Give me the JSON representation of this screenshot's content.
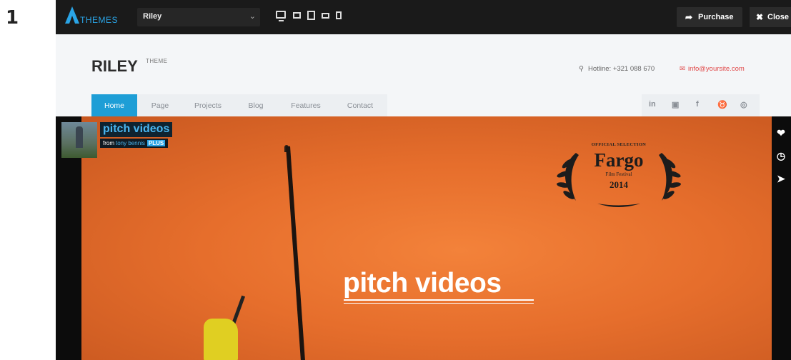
{
  "step_number": "1",
  "topbar": {
    "logo_text": "THEMES",
    "theme_select_value": "Riley",
    "purchase_label": "Purchase",
    "close_label": "Close",
    "icons": [
      "desktop-icon",
      "laptop-icon",
      "tablet-icon",
      "tablet-landscape-icon",
      "phone-icon"
    ]
  },
  "site": {
    "brand": "RILEY",
    "brand_sup": "THEME",
    "hotline": "Hotline: +321 088 670",
    "email": "info@yoursite.com",
    "nav": [
      {
        "label": "Home",
        "active": true
      },
      {
        "label": "Page",
        "active": false
      },
      {
        "label": "Projects",
        "active": false
      },
      {
        "label": "Blog",
        "active": false
      },
      {
        "label": "Features",
        "active": false
      },
      {
        "label": "Contact",
        "active": false
      }
    ],
    "social": [
      "in",
      "▣",
      "f",
      "♉",
      "◎"
    ]
  },
  "video": {
    "title": "pitch videos",
    "from_label": "from",
    "author": "tony bennis",
    "badge": "PLUS",
    "fargo_official": "OFFICIAL SELECTION",
    "fargo_name": "Fargo",
    "fargo_festival": "Film Festival",
    "fargo_year": "2014",
    "overlay_title": "pitch videos",
    "side_icons": [
      "heart-icon",
      "clock-icon",
      "send-icon"
    ]
  },
  "colors": {
    "accent": "#1e9ed6",
    "topbar": "#1a1a1a",
    "video_orange": "#e66e2c",
    "email_red": "#e14a4a"
  }
}
